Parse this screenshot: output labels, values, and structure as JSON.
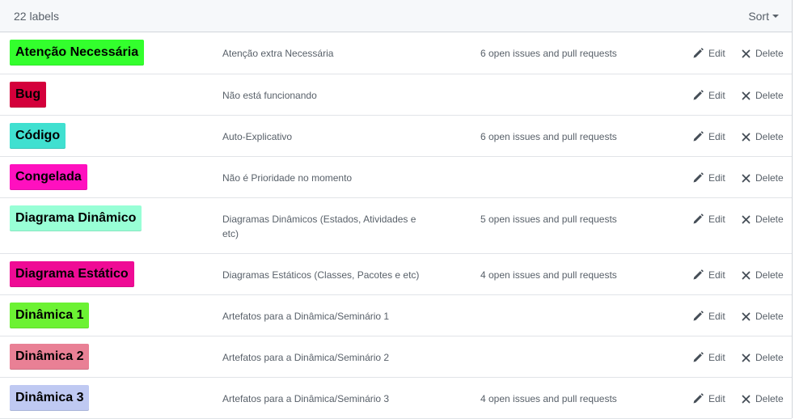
{
  "header": {
    "count_label": "22 labels",
    "sort_label": "Sort"
  },
  "actions": {
    "edit": "Edit",
    "delete": "Delete"
  },
  "labels": [
    {
      "name": "Atenção Necessária",
      "color": "#33ff2d",
      "description": "Atenção extra Necessária",
      "issues": "6 open issues and pull requests"
    },
    {
      "name": "Bug",
      "color": "#d4003b",
      "description": "Não está funcionando",
      "issues": ""
    },
    {
      "name": "Código",
      "color": "#40e0d0",
      "description": "Auto-Explicativo",
      "issues": "6 open issues and pull requests"
    },
    {
      "name": "Congelada",
      "color": "#ff10bf",
      "description": "Não é Prioridade no momento",
      "issues": ""
    },
    {
      "name": "Diagrama Dinâmico",
      "color": "#98ffd6",
      "description": "Diagramas Dinâmicos (Estados, Atividades e etc)",
      "issues": "5 open issues and pull requests"
    },
    {
      "name": "Diagrama Estático",
      "color": "#ef0b95",
      "description": "Diagramas Estáticos (Classes, Pacotes e etc)",
      "issues": "4 open issues and pull requests"
    },
    {
      "name": "Dinâmica 1",
      "color": "#6cf233",
      "description": "Artefatos para a Dinâmica/Seminário 1",
      "issues": ""
    },
    {
      "name": "Dinâmica 2",
      "color": "#e98095",
      "description": "Artefatos para a Dinâmica/Seminário 2",
      "issues": ""
    },
    {
      "name": "Dinâmica 3",
      "color": "#bfc9f2",
      "description": "Artefatos para a Dinâmica/Seminário 3",
      "issues": "4 open issues and pull requests"
    }
  ]
}
